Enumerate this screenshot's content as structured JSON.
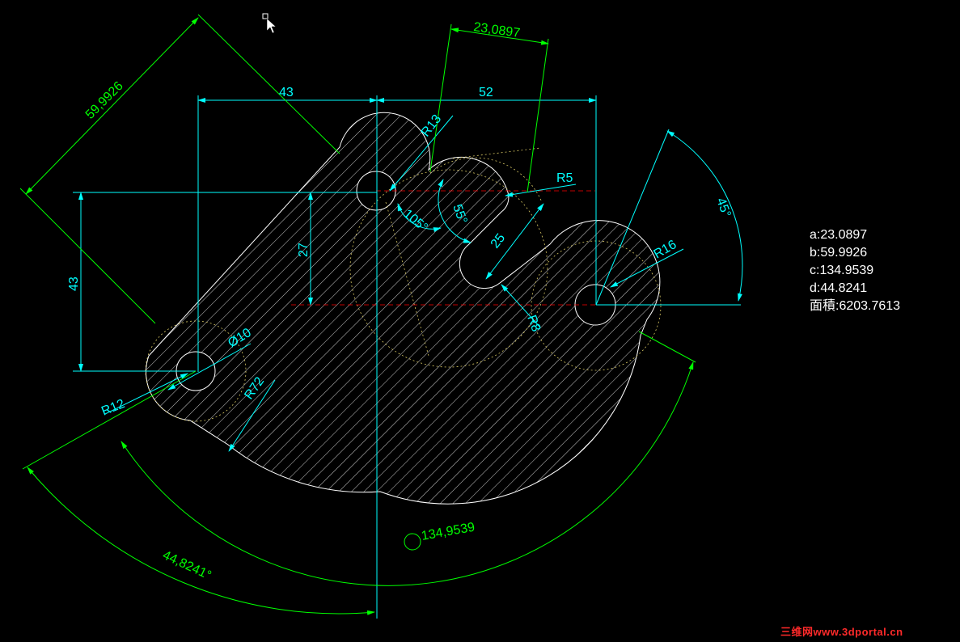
{
  "dimensions": {
    "a_aligned": "23,0897",
    "b_aligned": "59,9926",
    "horiz_left": "43",
    "horiz_right": "52",
    "vert_left": "43",
    "vert_inner": "27",
    "slot_len": "25",
    "angle_105": "105°",
    "angle_55": "55°",
    "angle_45": "45°",
    "arc_len": "134,9539",
    "angle_bottom": "44,8241°",
    "r13": "R13",
    "r5": "R5",
    "r16": "R16",
    "r8": "R8",
    "dia10": "Ø10",
    "r72": "R72",
    "r12": "R12"
  },
  "results": {
    "a": "a:23.0897",
    "b": "b:59.9926",
    "c": "c:134.9539",
    "d": "d:44.8241",
    "area": "面積:6203.7613"
  },
  "watermark": "三维网www.3dportal.cn",
  "colors": {
    "background": "#000000",
    "geometry": "#ffffff",
    "dimension_cyan": "#00ffff",
    "dimension_green": "#00ff00",
    "centerline_red": "#ff0000",
    "watermark": "#ff2a2a"
  }
}
